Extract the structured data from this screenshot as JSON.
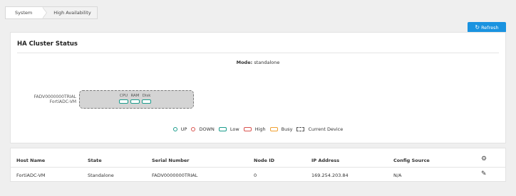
{
  "breadcrumb": {
    "items": [
      "System",
      "High Availability"
    ]
  },
  "toolbar": {
    "refresh_label": "Refresh",
    "refresh_icon": "refresh-icon"
  },
  "status": {
    "title": "HA Cluster Status",
    "mode_label": "Mode:",
    "mode_value": "standalone",
    "node": {
      "serial": "FADV0000000TRIAL",
      "name": "FortiADC-VM",
      "resources": [
        "CPU",
        "RAM",
        "Disk"
      ]
    },
    "legend": [
      {
        "label": "UP",
        "shape": "circle",
        "color": "#1a9c8c"
      },
      {
        "label": "DOWN",
        "shape": "circle",
        "color": "#d9534f"
      },
      {
        "label": "Low",
        "shape": "rect",
        "color": "#1a9c8c"
      },
      {
        "label": "High",
        "shape": "rect",
        "color": "#d9534f"
      },
      {
        "label": "Busy",
        "shape": "rect",
        "color": "#f0a030"
      },
      {
        "label": "Current Device",
        "shape": "dashed",
        "color": "#555555"
      }
    ]
  },
  "table": {
    "columns": [
      "Host Name",
      "State",
      "Serial Number",
      "Node ID",
      "IP Address",
      "Config Source"
    ],
    "settings_icon": "gear-icon",
    "rows": [
      {
        "host_name": "FortiADC-VM",
        "state": "Standalone",
        "serial_number": "FADV0000000TRIAL",
        "node_id": "0",
        "ip_address": "169.254.203.84",
        "config_source": "N/A",
        "edit_icon": "pencil-icon"
      }
    ]
  },
  "colors": {
    "accent": "#1a93e0",
    "up": "#1a9c8c",
    "down": "#d9534f",
    "busy": "#f0a030"
  }
}
